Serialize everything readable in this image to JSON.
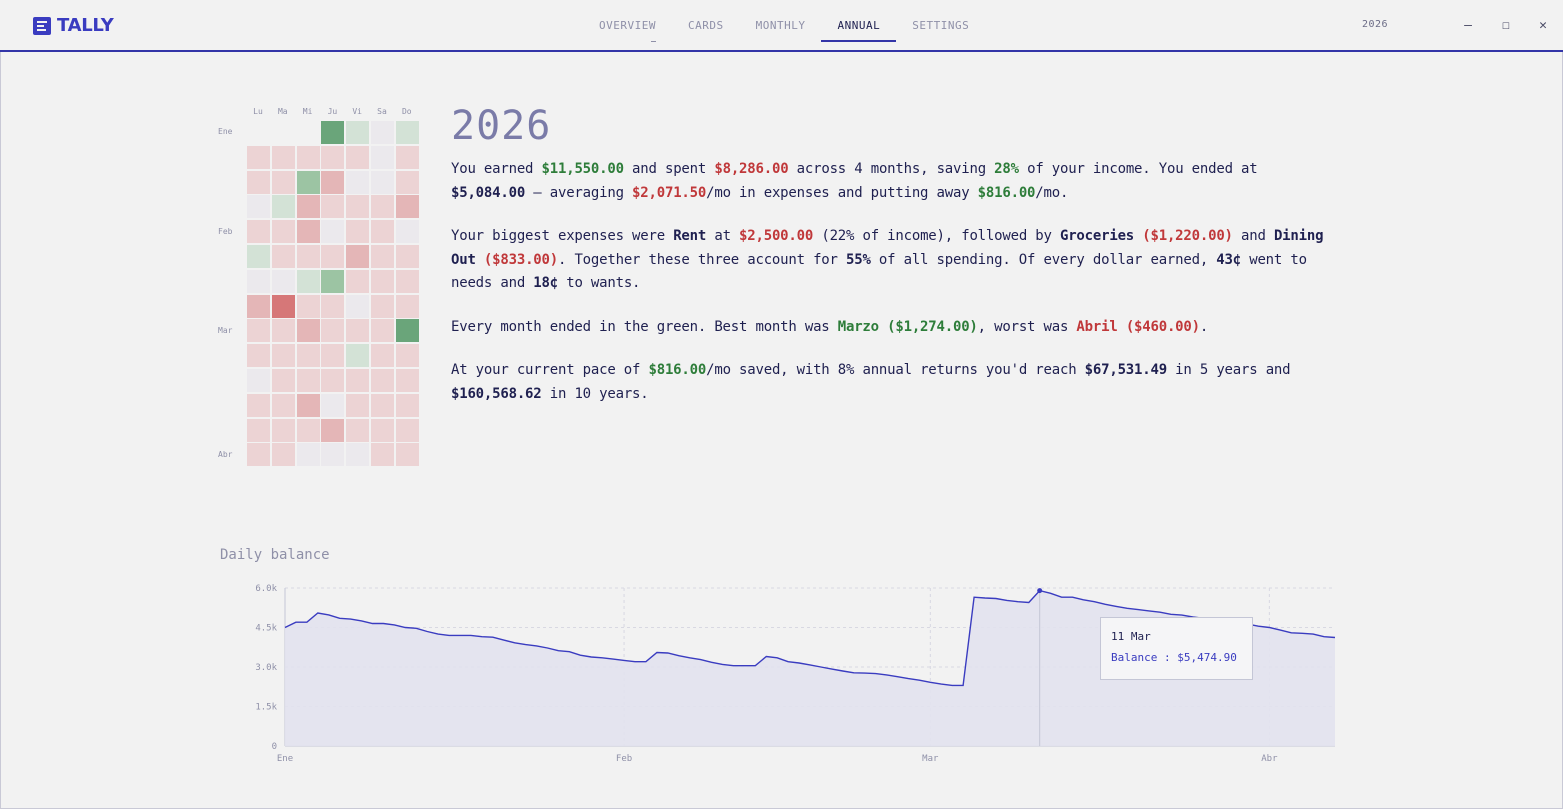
{
  "app": {
    "name": "TALLY"
  },
  "nav": {
    "items": [
      "OVERVIEW",
      "CARDS",
      "MONTHLY",
      "ANNUAL",
      "SETTINGS"
    ],
    "active": "ANNUAL"
  },
  "header": {
    "year": "2026"
  },
  "window": {
    "minimize": "–",
    "maximize": "☐",
    "close": "✕"
  },
  "heatmap": {
    "weekdays": [
      "Lu",
      "Ma",
      "Mi",
      "Ju",
      "Vi",
      "Sa",
      "Do"
    ],
    "month_labels": [
      "Ene",
      "Feb",
      "Mar",
      "Abr"
    ],
    "month_label_rows": [
      0.5,
      4.5,
      8.5,
      13.5
    ],
    "rows": [
      [
        null,
        null,
        null,
        3,
        1,
        0,
        1
      ],
      [
        -1,
        -1,
        -1,
        -1,
        -1,
        0,
        -1
      ],
      [
        -1,
        -1,
        2,
        -2,
        0,
        0,
        -1
      ],
      [
        0,
        1,
        -2,
        -1,
        -1,
        -1,
        -2
      ],
      [
        -1,
        -1,
        -2,
        0,
        -1,
        -1,
        0
      ],
      [
        1,
        -1,
        -1,
        -1,
        -2,
        -1,
        -1
      ],
      [
        0,
        0,
        1,
        2,
        -1,
        -1,
        -1
      ],
      [
        -2,
        -3,
        -1,
        -1,
        0,
        -1,
        -1
      ],
      [
        -1,
        -1,
        -2,
        -1,
        -1,
        -1,
        3
      ],
      [
        -1,
        -1,
        -1,
        -1,
        1,
        -1,
        -1
      ],
      [
        0,
        -1,
        -1,
        -1,
        -1,
        -1,
        -1
      ],
      [
        -1,
        -1,
        -2,
        0,
        -1,
        -1,
        -1
      ],
      [
        -1,
        -1,
        -1,
        -2,
        -1,
        -1,
        -1
      ],
      [
        -1,
        -1,
        0,
        0,
        0,
        -1,
        -1
      ]
    ]
  },
  "summary": {
    "title": "2026",
    "p1": {
      "earned": "$11,550.00",
      "spent": "$8,286.00",
      "months": "4 months",
      "saving_pct": "28%",
      "ended": "$5,084.00",
      "avg_expense": "$2,071.50",
      "avg_saving": "$816.00"
    },
    "p2": {
      "cat1": "Rent",
      "cat1_amount": "$2,500.00",
      "cat1_pct": "22%",
      "cat2": "Groceries",
      "cat2_amount": "($1,220.00)",
      "cat3": "Dining Out",
      "cat3_amount": "($833.00)",
      "three_pct": "55%",
      "needs": "43¢",
      "wants": "18¢"
    },
    "p3": {
      "best_month": "Marzo",
      "best_amount": "($1,274.00)",
      "worst_month": "Abril",
      "worst_amount": "($460.00)"
    },
    "p4": {
      "pace": "$816.00",
      "returns": "8%",
      "five_year": "$67,531.49",
      "ten_year": "$160,568.62"
    }
  },
  "chart_data": {
    "type": "area",
    "title": "Daily balance",
    "yticks": [
      "0",
      "1.5k",
      "3.0k",
      "4.5k",
      "6.0k"
    ],
    "ylim": [
      0,
      6000
    ],
    "xticks": [
      "Ene",
      "Feb",
      "Mar",
      "Abr"
    ],
    "x_days": [
      0,
      31,
      59,
      90
    ],
    "series": [
      {
        "values": [
          4500,
          4700,
          4700,
          5050,
          4980,
          4850,
          4820,
          4750,
          4650,
          4650,
          4600,
          4500,
          4470,
          4350,
          4250,
          4200,
          4200,
          4200,
          4150,
          4130,
          4020,
          3920,
          3850,
          3800,
          3720,
          3620,
          3580,
          3450,
          3380,
          3350,
          3300,
          3250,
          3200,
          3200,
          3550,
          3530,
          3430,
          3350,
          3280,
          3180,
          3100,
          3050,
          3050,
          3050,
          3400,
          3350,
          3200,
          3150,
          3080,
          3000,
          2920,
          2850,
          2780,
          2770,
          2750,
          2700,
          2630,
          2560,
          2500,
          2420,
          2350,
          2300,
          2300,
          5650,
          5620,
          5600,
          5530,
          5480,
          5450,
          5900,
          5800,
          5650,
          5650,
          5550,
          5480,
          5380,
          5300,
          5230,
          5180,
          5130,
          5080,
          5000,
          4970,
          4900,
          4850,
          4780,
          4720,
          4680,
          4630,
          4550,
          4500,
          4400,
          4300,
          4280,
          4250,
          4150,
          4120
        ]
      }
    ],
    "tooltip": {
      "date": "11 Mar",
      "label": "Balance : $5,474.90",
      "index": 69
    },
    "colors": {
      "line": "#3a3cc0",
      "fill": "#e2e2ee",
      "grid": "#d8d8e2"
    }
  },
  "colors": {
    "accent": "#3335a8",
    "positive": "#2e7d3a",
    "negative": "#c0383a"
  }
}
